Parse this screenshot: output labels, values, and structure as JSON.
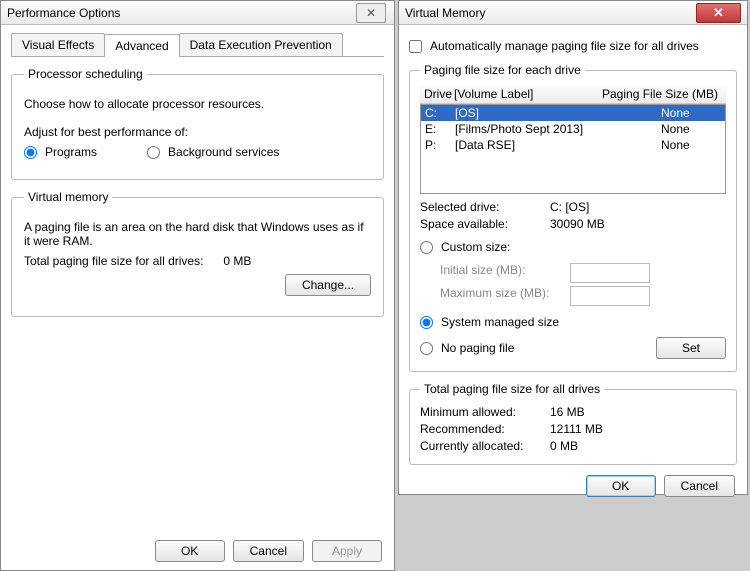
{
  "perf": {
    "title": "Performance Options",
    "tabs": {
      "visual": "Visual Effects",
      "advanced": "Advanced",
      "dep": "Data Execution Prevention"
    },
    "ps": {
      "legend": "Processor scheduling",
      "intro": "Choose how to allocate processor resources.",
      "adjust": "Adjust for best performance of:",
      "programs": "Programs",
      "background": "Background services"
    },
    "vm": {
      "legend": "Virtual memory",
      "desc": "A paging file is an area on the hard disk that Windows uses as if it were RAM.",
      "total_lbl": "Total paging file size for all drives:",
      "total_val": "0 MB",
      "change": "Change..."
    },
    "buttons": {
      "ok": "OK",
      "cancel": "Cancel",
      "apply": "Apply"
    }
  },
  "vm": {
    "title": "Virtual Memory",
    "auto": "Automatically manage paging file size for all drives",
    "each": {
      "legend": "Paging file size for each drive",
      "hdr_drive": "Drive",
      "hdr_vol": "[Volume Label]",
      "hdr_pfs": "Paging File Size (MB)",
      "rows": [
        {
          "d": "C:",
          "v": "[OS]",
          "p": "None"
        },
        {
          "d": "E:",
          "v": "[Films/Photo Sept 2013]",
          "p": "None"
        },
        {
          "d": "P:",
          "v": "[Data RSE]",
          "p": "None"
        }
      ],
      "sel_lbl": "Selected drive:",
      "sel_val": "C:  [OS]",
      "space_lbl": "Space available:",
      "space_val": "30090 MB",
      "custom": "Custom size:",
      "init_lbl": "Initial size (MB):",
      "max_lbl": "Maximum size (MB):",
      "sys": "System managed size",
      "none": "No paging file",
      "set": "Set"
    },
    "tot": {
      "legend": "Total paging file size for all drives",
      "min_lbl": "Minimum allowed:",
      "min_val": "16 MB",
      "rec_lbl": "Recommended:",
      "rec_val": "12111 MB",
      "cur_lbl": "Currently allocated:",
      "cur_val": "0 MB"
    },
    "buttons": {
      "ok": "OK",
      "cancel": "Cancel"
    }
  }
}
